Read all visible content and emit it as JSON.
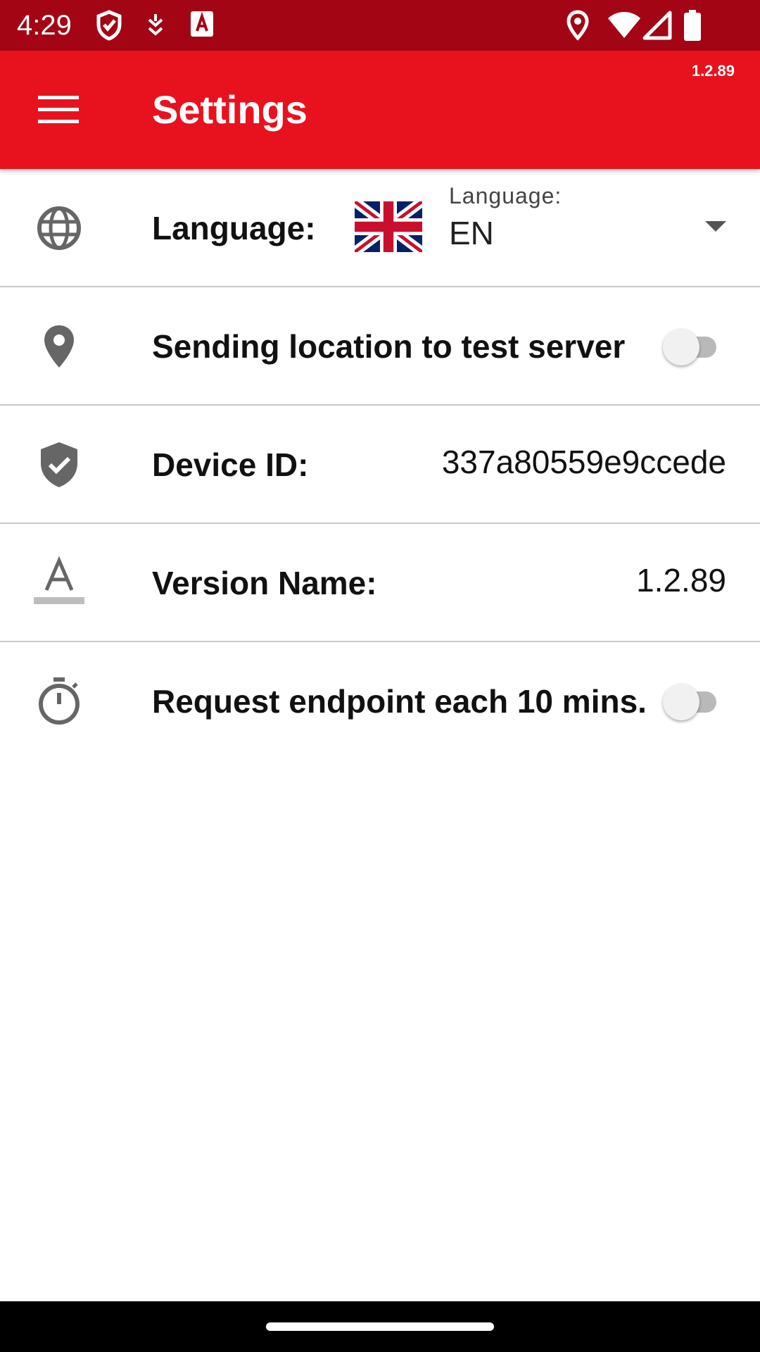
{
  "status_bar": {
    "time": "4:29",
    "icons": [
      "shield-icon",
      "download-icon",
      "font-a-icon",
      "location-icon",
      "wifi-icon",
      "signal-icon",
      "battery-icon"
    ]
  },
  "app_bar": {
    "title": "Settings",
    "version_badge": "1.2.89",
    "color": "#e8121f"
  },
  "settings": {
    "language": {
      "label": "Language:",
      "dropdown_caption": "Language:",
      "dropdown_value": "EN",
      "flag": "uk-flag-icon"
    },
    "location": {
      "label": "Sending location to test server",
      "enabled": false
    },
    "device": {
      "label": "Device ID:",
      "value": "337a80559e9ccede"
    },
    "version": {
      "label": "Version Name:",
      "value": "1.2.89"
    },
    "endpoint": {
      "label": "Request endpoint each 10 mins.",
      "enabled": false
    }
  },
  "colors": {
    "status_bar": "#a30515",
    "accent": "#e8121f",
    "icon_gray": "#666666"
  }
}
